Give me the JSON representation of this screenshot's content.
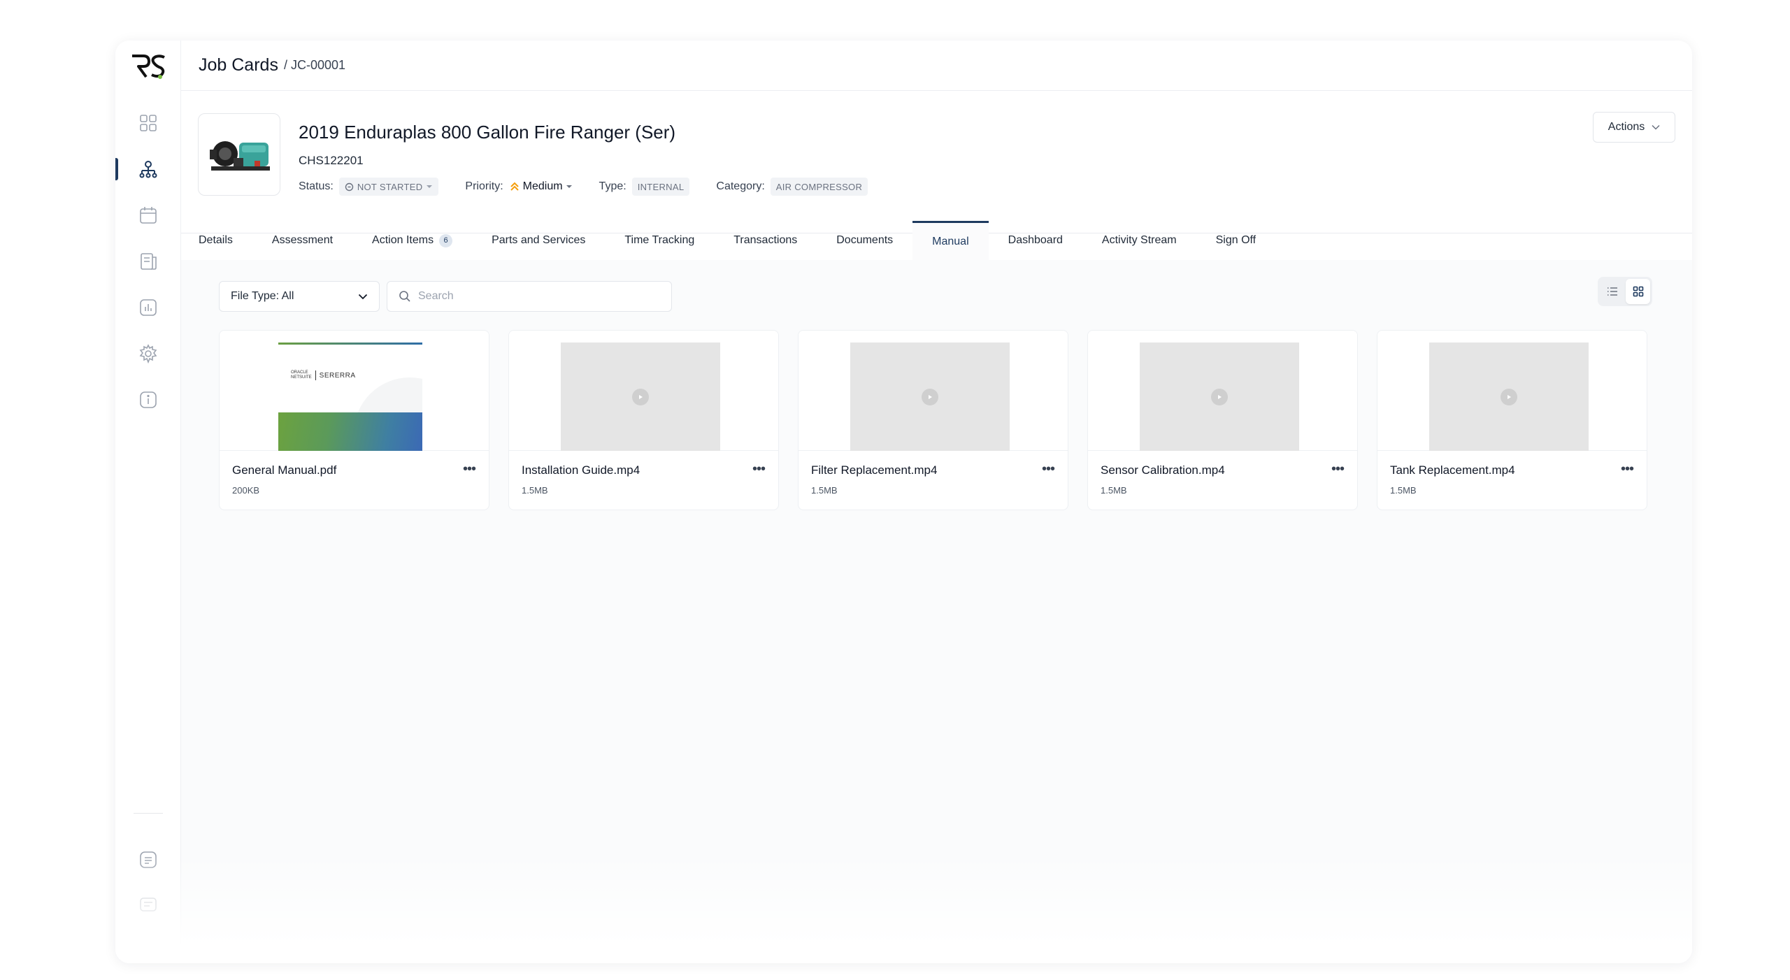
{
  "breadcrumb": {
    "root": "Job Cards",
    "current": "/ JC-00001"
  },
  "job": {
    "title": "2019 Enduraplas 800 Gallon Fire Ranger (Ser)",
    "code": "CHS122201",
    "status_label": "Status:",
    "status_value": "NOT STARTED",
    "priority_label": "Priority:",
    "priority_value": "Medium",
    "type_label": "Type:",
    "type_value": "INTERNAL",
    "category_label": "Category:",
    "category_value": "AIR COMPRESSOR",
    "actions_label": "Actions"
  },
  "tabs": [
    {
      "label": "Details"
    },
    {
      "label": "Assessment"
    },
    {
      "label": "Action Items",
      "badge": "6"
    },
    {
      "label": "Parts and Services"
    },
    {
      "label": "Time Tracking"
    },
    {
      "label": "Transactions"
    },
    {
      "label": "Documents"
    },
    {
      "label": "Manual"
    },
    {
      "label": "Dashboard"
    },
    {
      "label": "Activity Stream"
    },
    {
      "label": "Sign Off"
    }
  ],
  "filters": {
    "file_type": "File Type: All",
    "search_placeholder": "Search"
  },
  "files": [
    {
      "name": "General Manual.pdf",
      "size": "200KB",
      "kind": "pdf"
    },
    {
      "name": "Installation Guide.mp4",
      "size": "1.5MB",
      "kind": "video"
    },
    {
      "name": "Filter Replacement.mp4",
      "size": "1.5MB",
      "kind": "video"
    },
    {
      "name": "Sensor Calibration.mp4",
      "size": "1.5MB",
      "kind": "video"
    },
    {
      "name": "Tank Replacement.mp4",
      "size": "1.5MB",
      "kind": "video"
    }
  ],
  "pdf_cover": {
    "brand_left_1": "ORACLE",
    "brand_left_2": "NETSUITE",
    "brand_right": "SERERRA"
  },
  "colors": {
    "accent": "#1e3a5f",
    "priority": "#f59e0b"
  }
}
